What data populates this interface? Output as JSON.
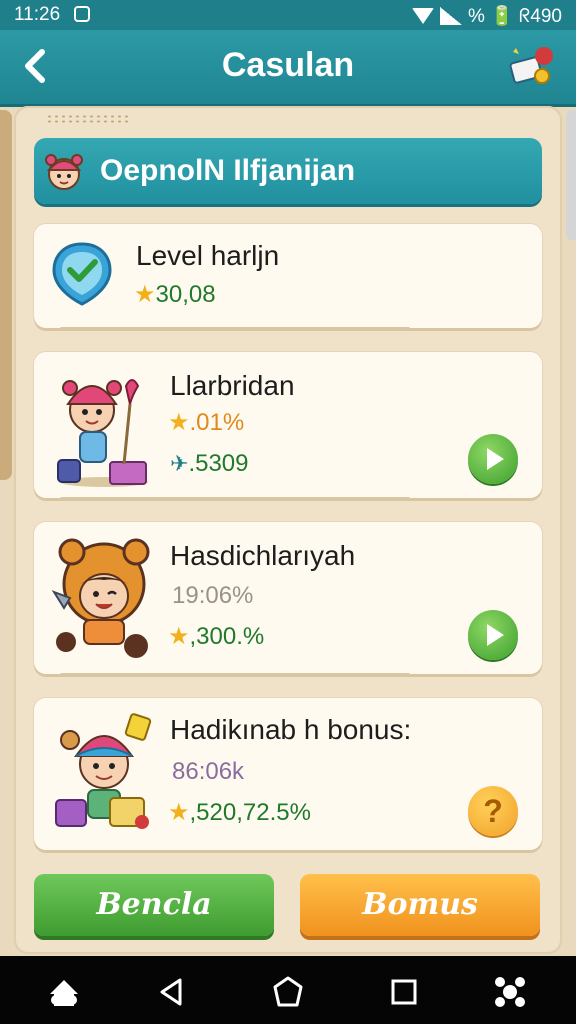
{
  "status": {
    "time": "11:26",
    "right_text": "% 🔋 ᖇ490"
  },
  "header": {
    "title": "Casulan"
  },
  "banner": {
    "text": "OepnolN Ilfjanijan"
  },
  "cards": [
    {
      "name": "Level harljn",
      "line1": "30,08"
    },
    {
      "name": "Llarbridan",
      "line1": ".01%",
      "line2": ".5309"
    },
    {
      "name": "Hasdichlarıyah",
      "line1": "19:06%",
      "line2": ",300.%"
    },
    {
      "name": "Hadikınab h bonus:",
      "line1": "86:06k",
      "line2": ",520,72.5%"
    }
  ],
  "buttons": {
    "left": "Bencla",
    "right": "Bomus"
  },
  "colors": {
    "teal": "#2190a0",
    "green": "#4bb33a",
    "orange": "#f3a126",
    "cream": "#fffaf0"
  }
}
